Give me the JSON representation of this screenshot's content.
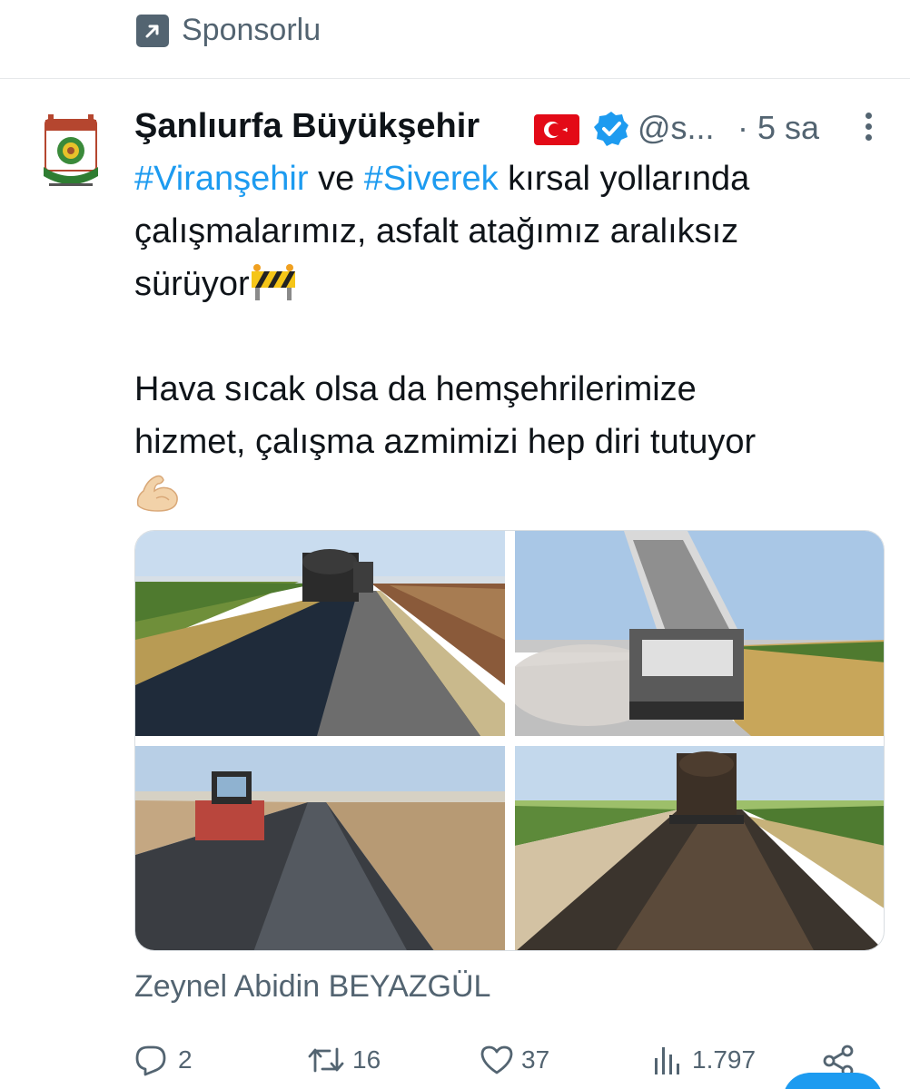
{
  "sponsored": {
    "label": "Sponsorlu",
    "icon": "promoted-arrow-icon"
  },
  "tweet": {
    "author_name": "Şanlıurfa Büyükşehir",
    "handle": "@s...",
    "timestamp": "· 5 sa",
    "avatar": "sanliurfa-municipality-logo",
    "text": {
      "line1_hashtag1": "#Viranşehir",
      "line1_mid": " ve ",
      "line1_hashtag2": "#Siverek",
      "line1_rest": " kırsal yollarında",
      "line2": "çalışmalarımız, asfalt atağımız aralıksız",
      "line3": "sürüyor",
      "line4": "Hava sıcak olsa da hemşehrilerimize",
      "line5": "hizmet, çalışma azmimizi hep diri tutuyor"
    },
    "media": [
      {
        "name": "asphalt-tanker-on-road-photo"
      },
      {
        "name": "dump-truck-paving-photo"
      },
      {
        "name": "road-roller-photo"
      },
      {
        "name": "tanker-spraying-asphalt-photo"
      }
    ],
    "photo_credit": "Zeynel Abidin BEYAZGÜL"
  },
  "actions": {
    "replies": "2",
    "reposts": "16",
    "likes": "37",
    "views": "1.797"
  },
  "colors": {
    "accent": "#1d9bf0",
    "secondary_text": "#536471",
    "primary_text": "#0f1419",
    "flag_red": "#e30a17"
  }
}
